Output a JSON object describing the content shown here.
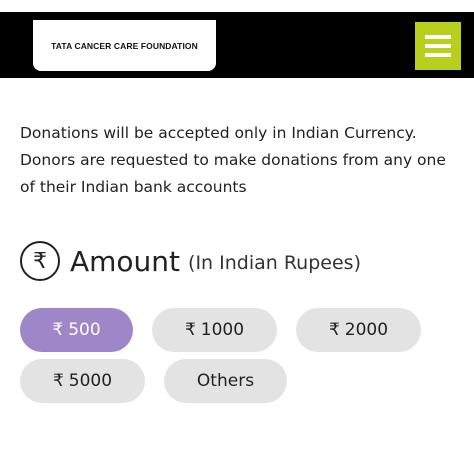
{
  "header": {
    "logo_text": "TATA CANCER CARE FOUNDATION",
    "menu_icon": "hamburger-icon",
    "menu_color": "#b9cf1e"
  },
  "notice": {
    "text": "Donations will be accepted only in Indian Currency. Donors are requested to make donations from any one of their Indian bank accounts"
  },
  "amount": {
    "icon": "rupee-circle-icon",
    "title": "Amount",
    "subtitle": "(In Indian Rupees)"
  },
  "currency_symbol": "₹",
  "options": [
    {
      "label": "500",
      "selected": true
    },
    {
      "label": "1000",
      "selected": false
    },
    {
      "label": "2000",
      "selected": false
    },
    {
      "label": "5000",
      "selected": false
    },
    {
      "label": "Others",
      "selected": false
    }
  ],
  "colors": {
    "selected_pill": "#9e86c8",
    "pill": "#e3e3e3",
    "header": "#000000"
  }
}
